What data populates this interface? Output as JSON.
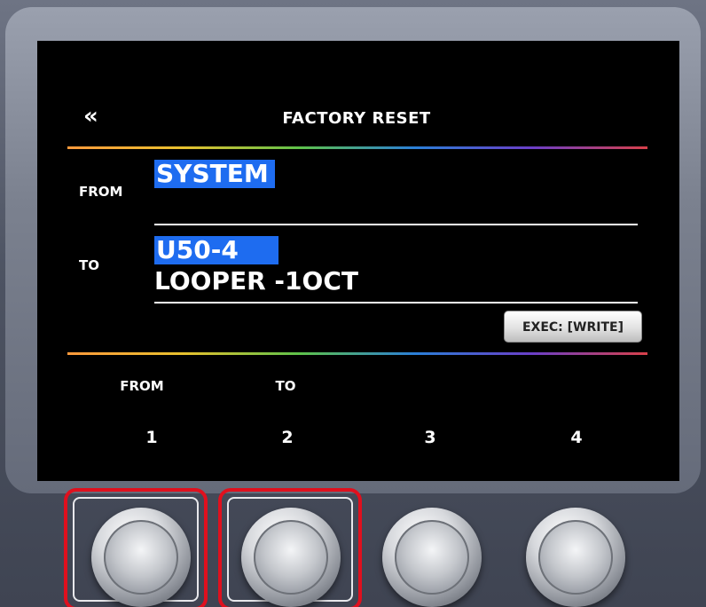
{
  "screen": {
    "back_glyph": "«",
    "title": "FACTORY RESET",
    "from_label": "FROM",
    "from_value": "SYSTEM",
    "to_label": "TO",
    "to_value": "U50-4",
    "to_patch_name": "LOOPER -1OCT",
    "exec_button": "EXEC: [WRITE]",
    "function_labels": [
      "FROM",
      "TO",
      "",
      ""
    ],
    "function_numbers": [
      "1",
      "2",
      "3",
      "4"
    ]
  },
  "knobs": {
    "count": 4,
    "highlighted": [
      1,
      2
    ],
    "highlight_color": "#e0101e"
  },
  "colors": {
    "selection": "#1e6cf0",
    "screen_bg": "#000000"
  }
}
